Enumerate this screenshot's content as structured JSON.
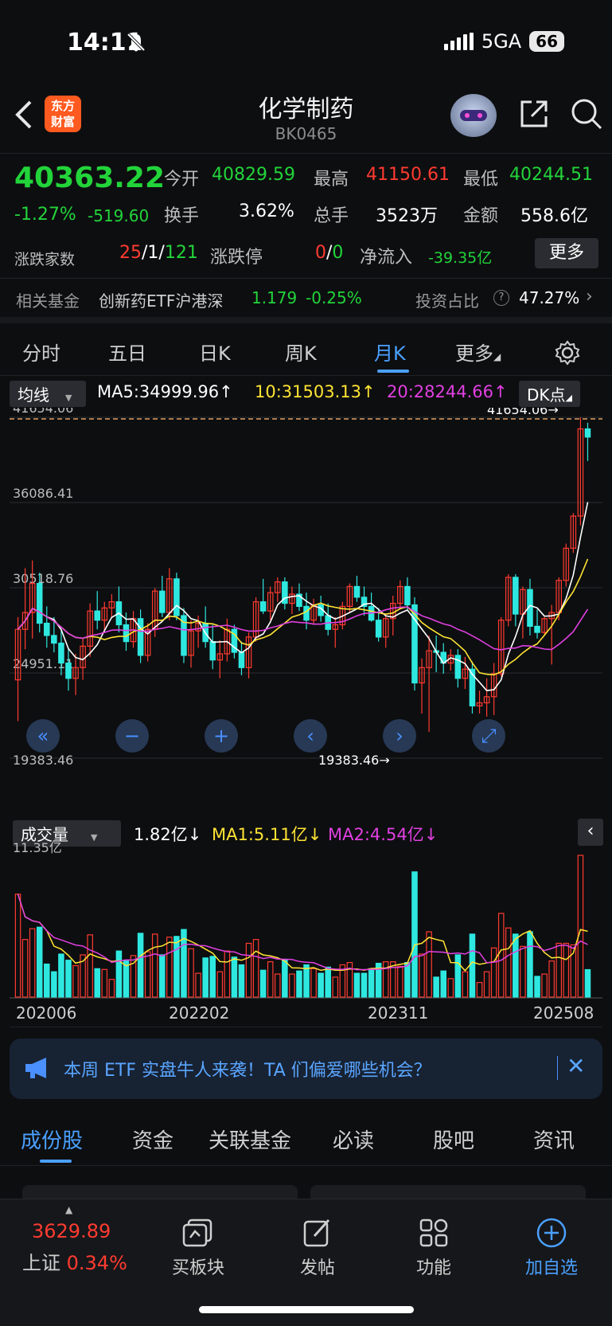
{
  "status_bar": {
    "time": "14:11",
    "network": "5GA",
    "battery": "66"
  },
  "header": {
    "logo_text_1": "东方",
    "logo_text_2": "财富",
    "title": "化学制药",
    "code": "BK0465"
  },
  "quote": {
    "price": "40363.22",
    "change_pct": "-1.27%",
    "change_val": "-519.60",
    "open_label": "今开",
    "open": "40829.59",
    "high_label": "最高",
    "high": "41150.61",
    "low_label": "最低",
    "low": "40244.51",
    "turnover_label": "换手",
    "turnover": "3.62%",
    "volume_label": "总手",
    "volume": "3523万",
    "amount_label": "金额",
    "amount": "558.6亿",
    "breadth_label": "涨跌家数",
    "breadth_up": "25",
    "breadth_flat": "1",
    "breadth_down": "121",
    "limit_label": "涨跌停",
    "limit_up": "0",
    "limit_down": "0",
    "netflow_label": "净流入",
    "netflow": "-39.35亿",
    "more_button": "更多"
  },
  "fund_row": {
    "label": "相关基金",
    "fund_name": "创新药ETF沪港深",
    "fund_price": "1.179",
    "fund_change": "-0.25%",
    "ratio_label": "投资占比",
    "ratio": "47.27%"
  },
  "period_tabs": [
    "分时",
    "五日",
    "日K",
    "周K",
    "月K",
    "更多"
  ],
  "active_period": "月K",
  "ma_row": {
    "dropdown": "均线",
    "ma5": "MA5:34999.96",
    "ma10": "10:31503.13",
    "ma20": "20:28244.66",
    "dk_button": "DK点"
  },
  "price_axis": [
    "41654.06",
    "36086.41",
    "30518.76",
    "24951.11",
    "19383.46"
  ],
  "price_markers": {
    "high": "41654.06",
    "low": "19383.46"
  },
  "vol_row": {
    "dropdown": "成交量",
    "vol": "1.82亿",
    "ma1": "MA1:5.11亿",
    "ma2": "MA2:4.54亿"
  },
  "vol_axis": "11.35亿",
  "x_axis": [
    "202006",
    "202202",
    "202311",
    "202508"
  ],
  "colors": {
    "up": "#ff3b30",
    "down": "#2ee8e0",
    "ma5": "#ffffff",
    "ma10": "#ffe433",
    "ma20": "#e040e0",
    "accent": "#4aa0ff"
  },
  "chart_data": {
    "type": "candlestick",
    "title": "",
    "ylim": [
      19383.46,
      41654.06
    ],
    "ohlc": [
      [
        24500,
        28600,
        21800,
        27800
      ],
      [
        27800,
        31800,
        26500,
        28900
      ],
      [
        28900,
        32300,
        27200,
        30800
      ],
      [
        30800,
        31500,
        27600,
        28200
      ],
      [
        28200,
        29300,
        26600,
        27400
      ],
      [
        27400,
        28600,
        26300,
        26900
      ],
      [
        26900,
        27800,
        24800,
        25600
      ],
      [
        25600,
        26600,
        23800,
        24600
      ],
      [
        24600,
        26200,
        23500,
        25300
      ],
      [
        25300,
        27200,
        24500,
        26700
      ],
      [
        26700,
        29500,
        26000,
        29000
      ],
      [
        29000,
        30300,
        27800,
        28400
      ],
      [
        28400,
        29600,
        27600,
        29200
      ],
      [
        29200,
        30100,
        28600,
        29600
      ],
      [
        29600,
        30600,
        27600,
        28100
      ],
      [
        28100,
        28900,
        26400,
        27000
      ],
      [
        27000,
        29000,
        26600,
        28500
      ],
      [
        28500,
        29100,
        25600,
        26100
      ],
      [
        26100,
        28200,
        25700,
        27800
      ],
      [
        27800,
        30500,
        27300,
        30300
      ],
      [
        30300,
        31300,
        28600,
        28900
      ],
      [
        28900,
        31800,
        28400,
        31100
      ],
      [
        31100,
        31500,
        28400,
        28700
      ],
      [
        28700,
        29200,
        25600,
        26100
      ],
      [
        26100,
        28400,
        25300,
        27700
      ],
      [
        27700,
        28700,
        26600,
        28200
      ],
      [
        28200,
        29300,
        26600,
        27000
      ],
      [
        27000,
        28100,
        25200,
        25800
      ],
      [
        25800,
        27100,
        24600,
        26200
      ],
      [
        26200,
        28500,
        25700,
        27800
      ],
      [
        27800,
        28100,
        25900,
        26300
      ],
      [
        26300,
        27000,
        24800,
        25300
      ],
      [
        25300,
        27600,
        24600,
        27300
      ],
      [
        27300,
        29900,
        27000,
        29600
      ],
      [
        29600,
        31100,
        28800,
        29000
      ],
      [
        29000,
        30600,
        28400,
        30200
      ],
      [
        30200,
        31200,
        29600,
        30900
      ],
      [
        30900,
        31200,
        29100,
        29500
      ],
      [
        29500,
        30600,
        28800,
        30100
      ],
      [
        30100,
        30800,
        29000,
        29300
      ],
      [
        29300,
        30200,
        27800,
        28400
      ],
      [
        28400,
        29800,
        28100,
        29400
      ],
      [
        29400,
        30000,
        28300,
        28700
      ],
      [
        28700,
        29500,
        27400,
        27800
      ],
      [
        27800,
        28600,
        26600,
        28100
      ],
      [
        28100,
        29600,
        27800,
        29300
      ],
      [
        29300,
        30800,
        28900,
        30600
      ],
      [
        30600,
        31300,
        29600,
        29900
      ],
      [
        29900,
        30600,
        28700,
        29300
      ],
      [
        29300,
        30200,
        28300,
        28400
      ],
      [
        28400,
        29200,
        27000,
        27300
      ],
      [
        27300,
        28800,
        26600,
        28500
      ],
      [
        28500,
        30000,
        27400,
        29500
      ],
      [
        29500,
        31000,
        29200,
        30600
      ],
      [
        30600,
        31200,
        29100,
        29400
      ],
      [
        29400,
        29900,
        23800,
        24300
      ],
      [
        24300,
        25900,
        22300,
        25300
      ],
      [
        25300,
        27400,
        21100,
        26400
      ],
      [
        26400,
        27400,
        25000,
        26300
      ],
      [
        26300,
        26900,
        24900,
        25600
      ],
      [
        25600,
        26500,
        25100,
        26100
      ],
      [
        26100,
        26500,
        24000,
        24600
      ],
      [
        24600,
        26000,
        23900,
        25200
      ],
      [
        25200,
        25700,
        22300,
        22800
      ],
      [
        22800,
        23800,
        22300,
        23000
      ],
      [
        23000,
        24600,
        22100,
        23400
      ],
      [
        23400,
        25600,
        22200,
        24900
      ],
      [
        24900,
        28600,
        24700,
        28400
      ],
      [
        28400,
        31400,
        28000,
        31200
      ],
      [
        31200,
        31400,
        28000,
        28800
      ],
      [
        28800,
        30600,
        27200,
        30400
      ],
      [
        30400,
        31100,
        27400,
        28000
      ],
      [
        28000,
        29100,
        27200,
        27600
      ],
      [
        27600,
        28600,
        27400,
        28500
      ],
      [
        28500,
        29400,
        25500,
        28900
      ],
      [
        28900,
        31200,
        28400,
        31000
      ],
      [
        31000,
        33400,
        30600,
        33100
      ],
      [
        33100,
        35400,
        32800,
        35200
      ],
      [
        35200,
        41654.06,
        34600,
        40900
      ],
      [
        40900,
        41300,
        38800,
        40363.22
      ]
    ],
    "ma5": "MA5:34999.96",
    "ma10": "10:31503.13",
    "ma20": "20:28244.66"
  }
}
